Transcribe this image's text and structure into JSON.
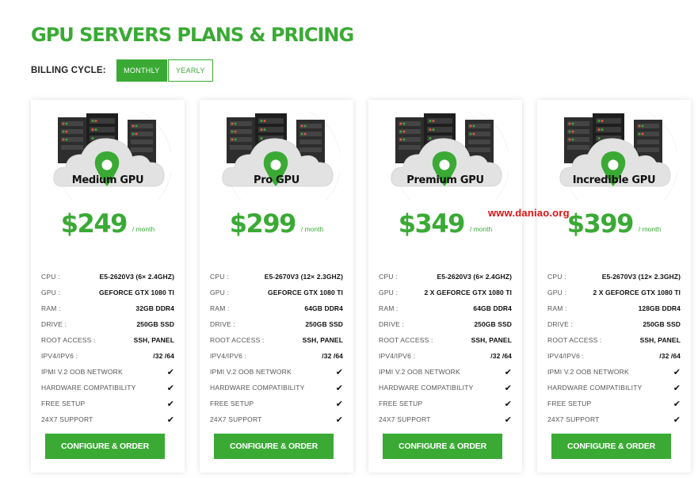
{
  "page": {
    "title": "GPU SERVERS PLANS & PRICING"
  },
  "billing": {
    "label": "BILLING CYCLE:",
    "monthly": "MONTHLY",
    "yearly": "YEARLY",
    "selected": "MONTHLY"
  },
  "colors": {
    "accent": "#3aaa35",
    "watermark": "#dd1111"
  },
  "icons": {
    "card_art": "server-cloud-pin-icon",
    "feature_check": "checkmark-icon"
  },
  "plans": [
    {
      "name": "Medium GPU",
      "price": "$249",
      "period": "/ month",
      "specs": [
        {
          "label": "CPU :",
          "value": "E5-2620V3 (6× 2.4GHZ)"
        },
        {
          "label": "GPU :",
          "value": "GEFORCE GTX 1080 TI"
        },
        {
          "label": "RAM :",
          "value": "32GB DDR4"
        },
        {
          "label": "DRIVE :",
          "value": "250GB SSD"
        },
        {
          "label": "ROOT ACCESS :",
          "value": "SSH, PANEL"
        },
        {
          "label": "IPV4/IPV6 :",
          "value": "/32 /64"
        }
      ],
      "features": [
        {
          "label": "IPMI V.2 OOB NETWORK",
          "value": "✔"
        },
        {
          "label": "HARDWARE COMPATIBILITY",
          "value": "✔"
        },
        {
          "label": "FREE SETUP",
          "value": "✔"
        },
        {
          "label": "24X7 SUPPORT",
          "value": "✔"
        }
      ],
      "button": "CONFIGURE & ORDER"
    },
    {
      "name": "Pro GPU",
      "price": "$299",
      "period": "/ month",
      "specs": [
        {
          "label": "CPU :",
          "value": "E5-2670V3 (12× 2.3GHZ)"
        },
        {
          "label": "GPU :",
          "value": "GEFORCE GTX 1080 TI"
        },
        {
          "label": "RAM :",
          "value": "64GB DDR4"
        },
        {
          "label": "DRIVE :",
          "value": "250GB SSD"
        },
        {
          "label": "ROOT ACCESS :",
          "value": "SSH, PANEL"
        },
        {
          "label": "IPV4/IPV6 :",
          "value": "/32 /64"
        }
      ],
      "features": [
        {
          "label": "IPMI V.2 OOB NETWORK",
          "value": "✔"
        },
        {
          "label": "HARDWARE COMPATIBILITY",
          "value": "✔"
        },
        {
          "label": "FREE SETUP",
          "value": "✔"
        },
        {
          "label": "24X7 SUPPORT",
          "value": "✔"
        }
      ],
      "button": "CONFIGURE & ORDER"
    },
    {
      "name": "Premium GPU",
      "price": "$349",
      "period": "/ month",
      "specs": [
        {
          "label": "CPU :",
          "value": "E5-2620V3 (6× 2.4GHZ)"
        },
        {
          "label": "GPU :",
          "value": "2 X GEFORCE GTX 1080 TI"
        },
        {
          "label": "RAM :",
          "value": "64GB DDR4"
        },
        {
          "label": "DRIVE :",
          "value": "250GB SSD"
        },
        {
          "label": "ROOT ACCESS :",
          "value": "SSH, PANEL"
        },
        {
          "label": "IPV4/IPV6 :",
          "value": "/32 /64"
        }
      ],
      "features": [
        {
          "label": "IPMI V.2 OOB NETWORK",
          "value": "✔"
        },
        {
          "label": "HARDWARE COMPATIBILITY",
          "value": "✔"
        },
        {
          "label": "FREE SETUP",
          "value": "✔"
        },
        {
          "label": "24X7 SUPPORT",
          "value": "✔"
        }
      ],
      "button": "CONFIGURE & ORDER"
    },
    {
      "name": "Incredible GPU",
      "price": "$399",
      "period": "/ month",
      "specs": [
        {
          "label": "CPU :",
          "value": "E5-2670V3 (12× 2.3GHZ)"
        },
        {
          "label": "GPU :",
          "value": "2 X GEFORCE GTX 1080 TI"
        },
        {
          "label": "RAM :",
          "value": "128GB DDR4"
        },
        {
          "label": "DRIVE :",
          "value": "250GB SSD"
        },
        {
          "label": "ROOT ACCESS :",
          "value": "SSH, PANEL"
        },
        {
          "label": "IPV4/IPV6 :",
          "value": "/32 /64"
        }
      ],
      "features": [
        {
          "label": "IPMI V.2 OOB NETWORK",
          "value": "✔"
        },
        {
          "label": "HARDWARE COMPATIBILITY",
          "value": "✔"
        },
        {
          "label": "FREE SETUP",
          "value": "✔"
        },
        {
          "label": "24X7 SUPPORT",
          "value": "✔"
        }
      ],
      "button": "CONFIGURE & ORDER"
    }
  ],
  "watermark": "www.daniao.org"
}
